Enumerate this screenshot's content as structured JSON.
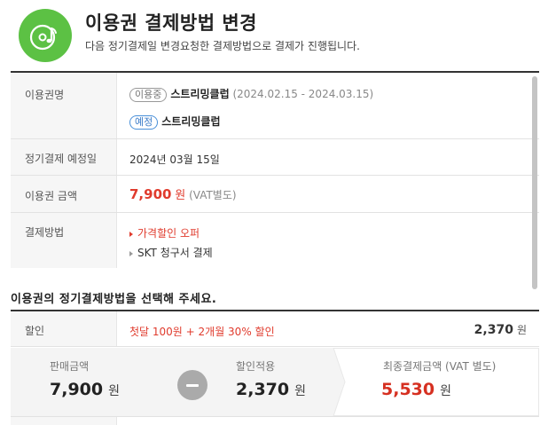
{
  "header": {
    "icon": "music-disc-icon",
    "accent_color": "#5cc144",
    "title": "이용권 결제방법 변경",
    "subtitle": "다음 정기결제일 변경요청한 결제방법으로 결제가 진행됩니다."
  },
  "info": {
    "ticket": {
      "label": "이용권명",
      "current_badge": "이용중",
      "current_name": "스트리밍클럽",
      "current_period": "(2024.02.15 - 2024.03.15)",
      "scheduled_badge": "예정",
      "scheduled_name": "스트리밍클럽"
    },
    "billing_date": {
      "label": "정기결제 예정일",
      "value": "2024년 03월 15일"
    },
    "amount": {
      "label": "이용권 금액",
      "price": "7,900",
      "unit": "원",
      "note": "(VAT별도)"
    },
    "payment": {
      "label": "결제방법",
      "options": [
        "가격할인 오퍼",
        "SKT 청구서 결제"
      ]
    }
  },
  "select_prompt": "이용권의 정기결제방법을 선택해 주세요.",
  "discount": {
    "label": "할인",
    "offer": "첫달 100원 + 2개월 30% 할인",
    "amount": "2,370",
    "unit": "원"
  },
  "summary": {
    "sale": {
      "label": "판매금액",
      "value": "7,900",
      "unit": "원"
    },
    "discount": {
      "label": "할인적용",
      "value": "2,370",
      "unit": "원"
    },
    "final": {
      "label": "최종결제금액 (VAT 별도)",
      "value": "5,530",
      "unit": "원"
    },
    "final_color": "#d63021"
  }
}
